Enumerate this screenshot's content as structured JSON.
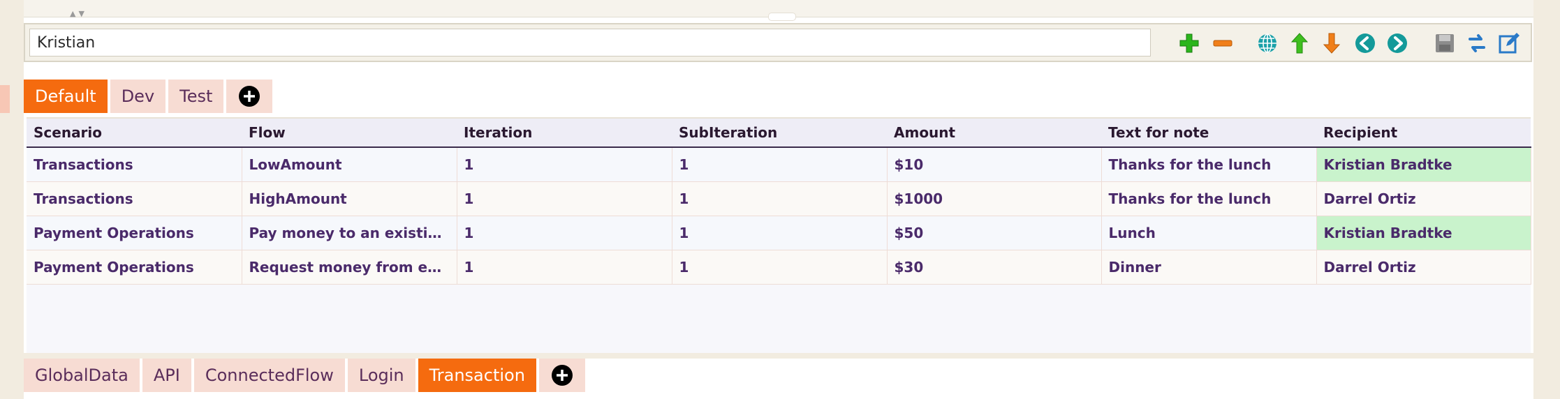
{
  "search": {
    "value": "Kristian"
  },
  "toolbar": {
    "icons": [
      {
        "name": "add-row-icon",
        "color": "#2bb51c"
      },
      {
        "name": "remove-row-icon",
        "color": "#f07f1a"
      },
      {
        "name": "globe-icon",
        "color": "#1aa0a8"
      },
      {
        "name": "arrow-up-icon",
        "color": "#3fbf1f"
      },
      {
        "name": "arrow-down-icon",
        "color": "#f07f1a"
      },
      {
        "name": "arrow-left-icon",
        "color": "#149a9a"
      },
      {
        "name": "arrow-right-icon",
        "color": "#149a9a"
      },
      {
        "name": "save-icon",
        "color": "#8c8c8c"
      },
      {
        "name": "refresh-icon",
        "color": "#2a7ac8"
      },
      {
        "name": "edit-icon",
        "color": "#2a7ac8"
      }
    ]
  },
  "env_tabs": {
    "items": [
      "Default",
      "Dev",
      "Test"
    ],
    "active": "Default"
  },
  "table": {
    "columns": [
      "Scenario",
      "Flow",
      "Iteration",
      "SubIteration",
      "Amount",
      "Text for note",
      "Recipient"
    ],
    "rows": [
      [
        "Transactions",
        "LowAmount",
        "1",
        "1",
        "$10",
        "Thanks for the lunch",
        "Kristian Bradtke"
      ],
      [
        "Transactions",
        "HighAmount",
        "1",
        "1",
        "$1000",
        "Thanks for the lunch",
        "Darrel Ortiz"
      ],
      [
        "Payment Operations",
        "Pay money to an existing c...",
        "1",
        "1",
        "$50",
        "Lunch",
        "Kristian Bradtke"
      ],
      [
        "Payment Operations",
        "Request money from existi...",
        "1",
        "1",
        "$30",
        "Dinner",
        "Darrel Ortiz"
      ]
    ],
    "highlight_color": "#c9f3cc",
    "highlighted": [
      "Kristian Bradtke"
    ]
  },
  "sheet_tabs": {
    "items": [
      "GlobalData",
      "API",
      "ConnectedFlow",
      "Login",
      "Transaction"
    ],
    "active": "Transaction"
  },
  "colors": {
    "accent": "#f56b0f",
    "tab_bg": "#f7dcd3",
    "text": "#4a2a6a"
  }
}
